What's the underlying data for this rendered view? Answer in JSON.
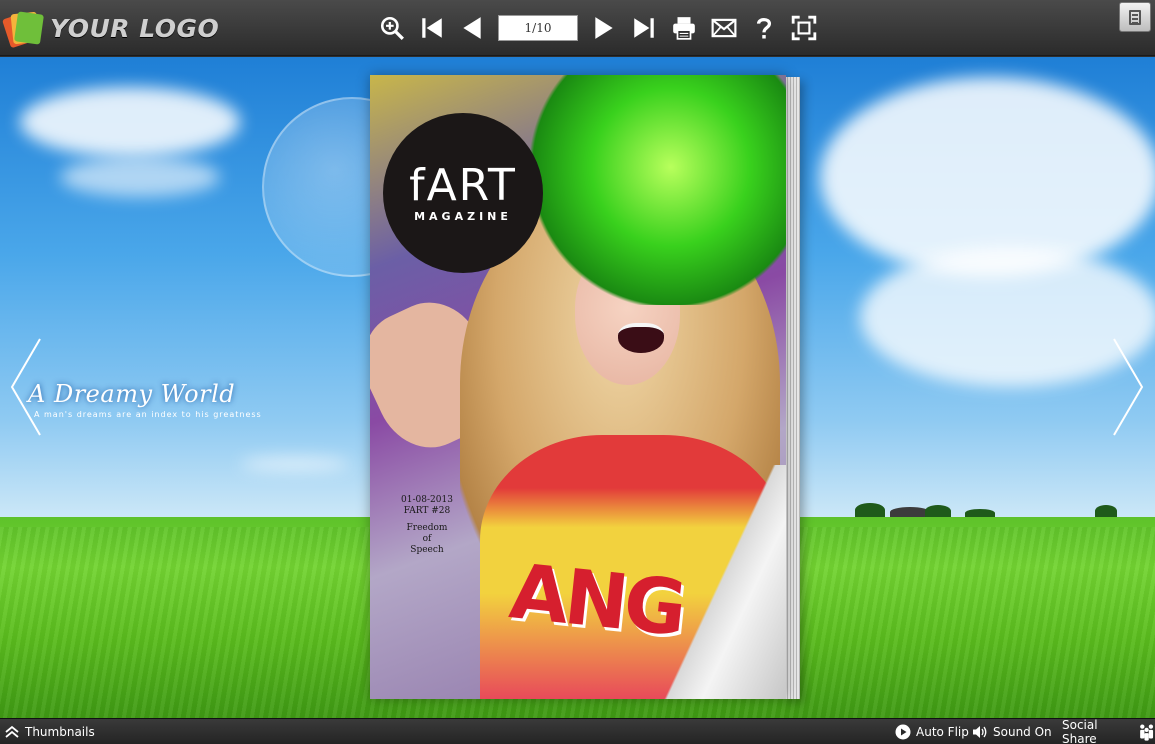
{
  "brand": {
    "logo_text": "YOUR LOGO"
  },
  "toolbar": {
    "page_indicator": "1/10",
    "tools": [
      "zoom-in-icon",
      "first-page-icon",
      "previous-page-icon",
      "next-page-icon",
      "last-page-icon",
      "print-icon",
      "email-icon",
      "help-icon",
      "fullscreen-icon"
    ]
  },
  "background": {
    "tagline_title": "A Dreamy World",
    "tagline_subtitle": "A man's dreams are an index to his greatness"
  },
  "cover": {
    "badge_title": "fART",
    "badge_subtitle": "MAGAZINE",
    "issue_date": "01-08-2013",
    "issue_number": "FART #28",
    "headline_line1": "Freedom",
    "headline_line2": "of",
    "headline_line3": "Speech"
  },
  "bottombar": {
    "thumbnails_label": "Thumbnails",
    "auto_flip_label": "Auto Flip",
    "sound_label": "Sound On",
    "social_share_label": "Social Share"
  }
}
